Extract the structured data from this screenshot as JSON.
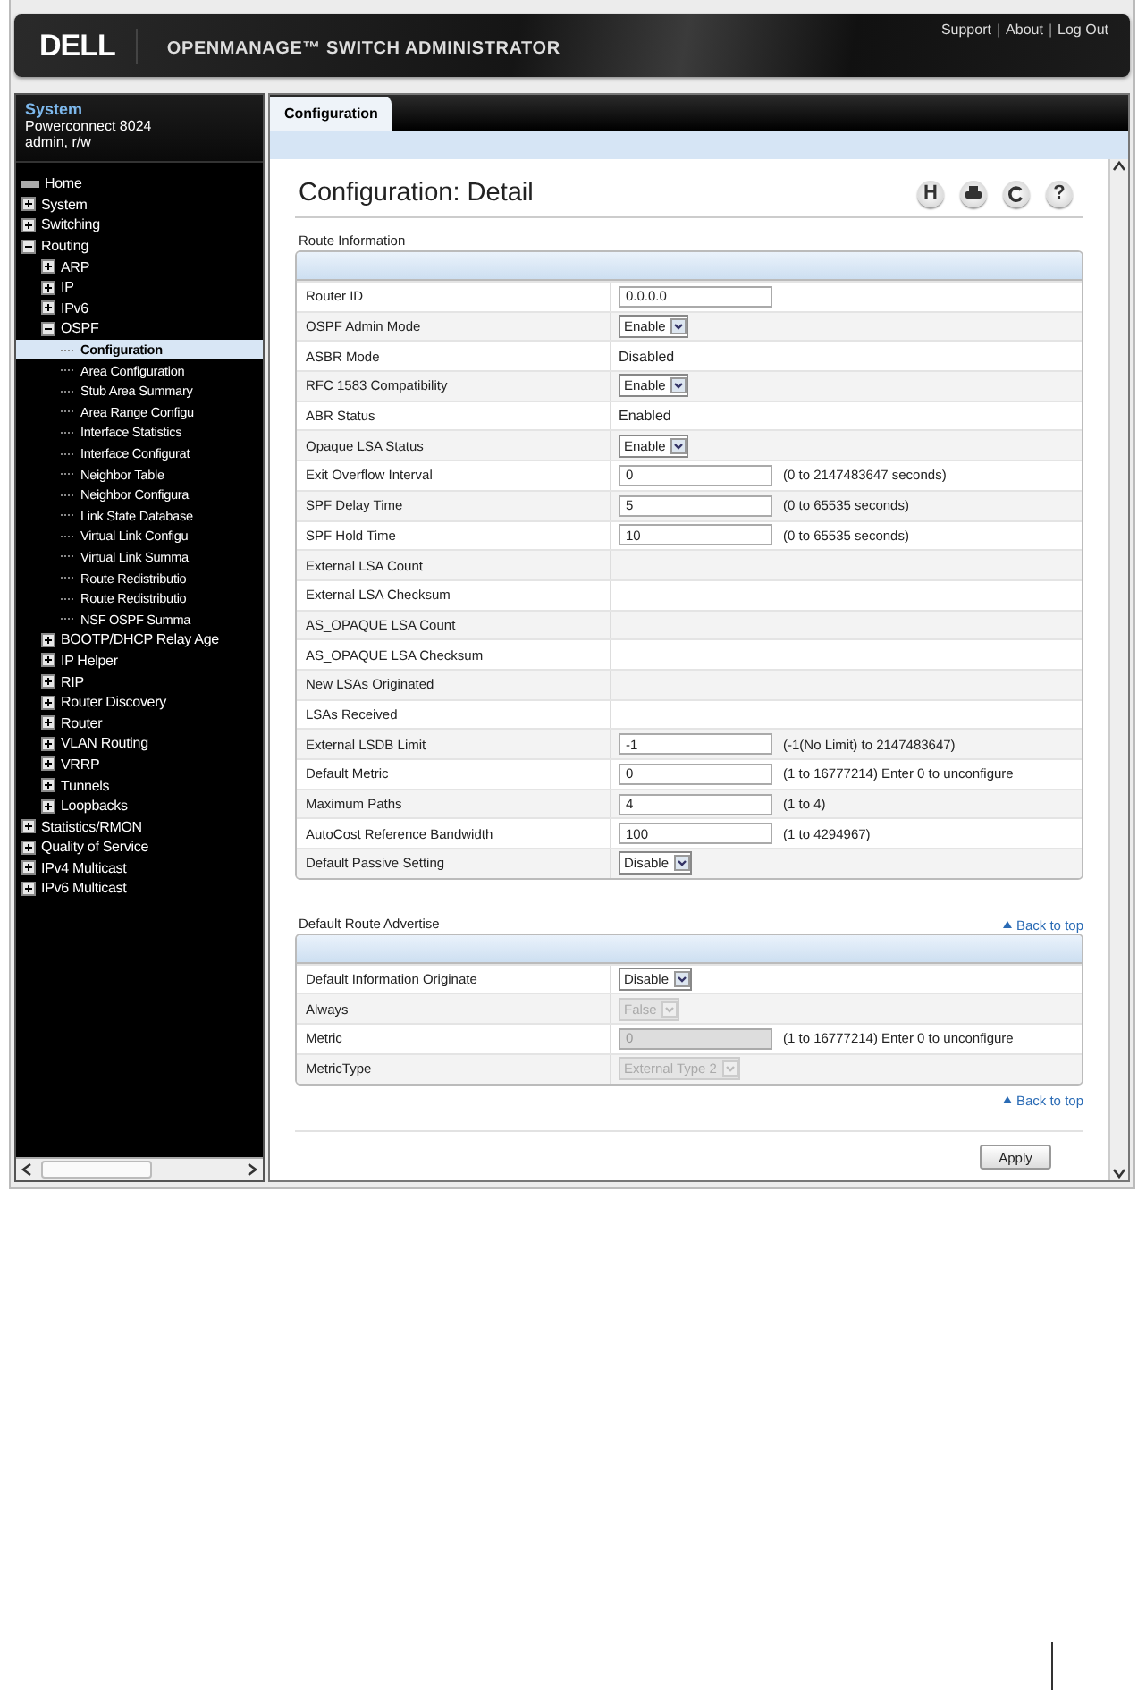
{
  "header": {
    "logo": "DELL",
    "title": "OPENMANAGE™ SWITCH ADMINISTRATOR",
    "links": [
      "Support",
      "About",
      "Log Out"
    ],
    "separators": [
      "|",
      "|"
    ]
  },
  "system": {
    "title": "System",
    "device": "Powerconnect 8024",
    "user": "admin, r/w"
  },
  "tree": [
    {
      "label": "Home",
      "kind": "home"
    },
    {
      "label": "System",
      "kind": "folder",
      "expanded": false
    },
    {
      "label": "Switching",
      "kind": "folder",
      "expanded": false
    },
    {
      "label": "Routing",
      "kind": "folder",
      "expanded": true,
      "children": [
        {
          "label": "ARP",
          "kind": "folder",
          "expanded": false
        },
        {
          "label": "IP",
          "kind": "folder",
          "expanded": false
        },
        {
          "label": "IPv6",
          "kind": "folder",
          "expanded": false
        },
        {
          "label": "OSPF",
          "kind": "folder",
          "expanded": true,
          "children": [
            {
              "label": "Configuration",
              "kind": "page",
              "selected": true
            },
            {
              "label": "Area Configuration",
              "kind": "page",
              "selected": false
            },
            {
              "label": "Stub Area Summary",
              "kind": "page",
              "selected": false
            },
            {
              "label": "Area Range Configu",
              "kind": "page",
              "selected": false
            },
            {
              "label": "Interface Statistics",
              "kind": "page",
              "selected": false
            },
            {
              "label": "Interface Configurat",
              "kind": "page",
              "selected": false
            },
            {
              "label": "Neighbor Table",
              "kind": "page",
              "selected": false
            },
            {
              "label": "Neighbor Configura",
              "kind": "page",
              "selected": false
            },
            {
              "label": "Link State Database",
              "kind": "page",
              "selected": false
            },
            {
              "label": "Virtual Link Configu",
              "kind": "page",
              "selected": false
            },
            {
              "label": "Virtual Link Summa",
              "kind": "page",
              "selected": false
            },
            {
              "label": "Route Redistributio",
              "kind": "page",
              "selected": false
            },
            {
              "label": "Route Redistributio",
              "kind": "page",
              "selected": false
            },
            {
              "label": "NSF OSPF Summa",
              "kind": "page",
              "selected": false
            }
          ]
        },
        {
          "label": "BOOTP/DHCP Relay Age",
          "kind": "folder",
          "expanded": false
        },
        {
          "label": "IP Helper",
          "kind": "folder",
          "expanded": false
        },
        {
          "label": "RIP",
          "kind": "folder",
          "expanded": false
        },
        {
          "label": "Router Discovery",
          "kind": "folder",
          "expanded": false
        },
        {
          "label": "Router",
          "kind": "folder",
          "expanded": false
        },
        {
          "label": "VLAN Routing",
          "kind": "folder",
          "expanded": false
        },
        {
          "label": "VRRP",
          "kind": "folder",
          "expanded": false
        },
        {
          "label": "Tunnels",
          "kind": "folder",
          "expanded": false
        },
        {
          "label": "Loopbacks",
          "kind": "folder",
          "expanded": false
        }
      ]
    },
    {
      "label": "Statistics/RMON",
      "kind": "folder",
      "expanded": false
    },
    {
      "label": "Quality of Service",
      "kind": "folder",
      "expanded": false
    },
    {
      "label": "IPv4 Multicast",
      "kind": "folder",
      "expanded": false
    },
    {
      "label": "IPv6 Multicast",
      "kind": "folder",
      "expanded": false
    }
  ],
  "tabs": [
    {
      "label": "Configuration",
      "selected": true
    }
  ],
  "page_title": "Configuration: Detail",
  "toolbar_icons": [
    {
      "kind": "glyph",
      "glyph": "H"
    },
    {
      "kind": "print"
    },
    {
      "kind": "refresh"
    },
    {
      "kind": "glyph",
      "glyph": "?"
    }
  ],
  "sections": [
    {
      "title": "Route Information",
      "rows": [
        {
          "label": "Router ID",
          "kind": "input",
          "value": "0.0.0.0"
        },
        {
          "label": "OSPF Admin Mode",
          "kind": "select",
          "value": "Enable"
        },
        {
          "label": "ASBR Mode",
          "kind": "text",
          "value": "Disabled"
        },
        {
          "label": "RFC 1583 Compatibility",
          "kind": "select",
          "value": "Enable"
        },
        {
          "label": "ABR Status",
          "kind": "text",
          "value": "Enabled"
        },
        {
          "label": "Opaque LSA Status",
          "kind": "select",
          "value": "Enable"
        },
        {
          "label": "Exit Overflow Interval",
          "kind": "input",
          "value": "0",
          "hint": "(0 to 2147483647 seconds)"
        },
        {
          "label": "SPF Delay Time",
          "kind": "input",
          "value": "5",
          "hint": "(0 to 65535 seconds)"
        },
        {
          "label": "SPF Hold Time",
          "kind": "input",
          "value": "10",
          "hint": "(0 to 65535 seconds)"
        },
        {
          "label": "External LSA Count",
          "kind": "empty"
        },
        {
          "label": "External LSA Checksum",
          "kind": "empty"
        },
        {
          "label": "AS_OPAQUE LSA Count",
          "kind": "empty"
        },
        {
          "label": "AS_OPAQUE LSA Checksum",
          "kind": "empty"
        },
        {
          "label": "New LSAs Originated",
          "kind": "empty"
        },
        {
          "label": "LSAs Received",
          "kind": "empty"
        },
        {
          "label": "External LSDB Limit",
          "kind": "input",
          "value": "-1",
          "hint": "(-1(No Limit) to 2147483647)"
        },
        {
          "label": "Default Metric",
          "kind": "input",
          "value": "0",
          "hint": "(1 to 16777214) Enter 0 to unconfigure"
        },
        {
          "label": "Maximum Paths",
          "kind": "input",
          "value": "4",
          "hint": "(1 to 4)"
        },
        {
          "label": "AutoCost Reference Bandwidth",
          "kind": "input",
          "value": "100",
          "hint": "(1 to 4294967)"
        },
        {
          "label": "Default Passive Setting",
          "kind": "select",
          "value": "Disable"
        }
      ]
    },
    {
      "title": "Default Route Advertise",
      "back_link": "Back to top",
      "rows": [
        {
          "label": "Default Information Originate",
          "kind": "select",
          "value": "Disable",
          "disabled": false
        },
        {
          "label": "Always",
          "kind": "select",
          "value": "False",
          "disabled": true
        },
        {
          "label": "Metric",
          "kind": "input",
          "value": "0",
          "hint": "(1 to 16777214) Enter 0 to unconfigure",
          "disabled": true
        },
        {
          "label": "MetricType",
          "kind": "select",
          "value": "External Type 2",
          "disabled": true
        }
      ]
    }
  ],
  "back_link": "Back to top",
  "apply_button": "Apply"
}
